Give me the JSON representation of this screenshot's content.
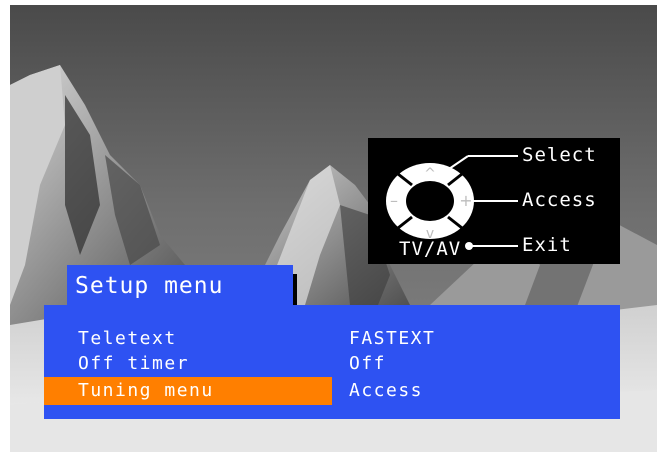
{
  "legend": {
    "select_label": "Select",
    "access_label": "Access",
    "exit_label": "Exit",
    "tvav_label": "TV/AV",
    "up_symbol": "^",
    "down_symbol": "v",
    "minus_symbol": "–",
    "plus_symbol": "+"
  },
  "menu": {
    "title": "Setup menu",
    "rows": [
      {
        "label": "Teletext",
        "value": "FASTEXT",
        "selected": false
      },
      {
        "label": "Off timer",
        "value": "Off",
        "selected": false
      },
      {
        "label": "Tuning menu",
        "value": "Access",
        "selected": true
      }
    ],
    "colors": {
      "panel": "#2e52f2",
      "highlight": "#ff7f00",
      "text": "#ffffff"
    }
  },
  "background": {
    "description_icon": "mountain-landscape-photo"
  }
}
